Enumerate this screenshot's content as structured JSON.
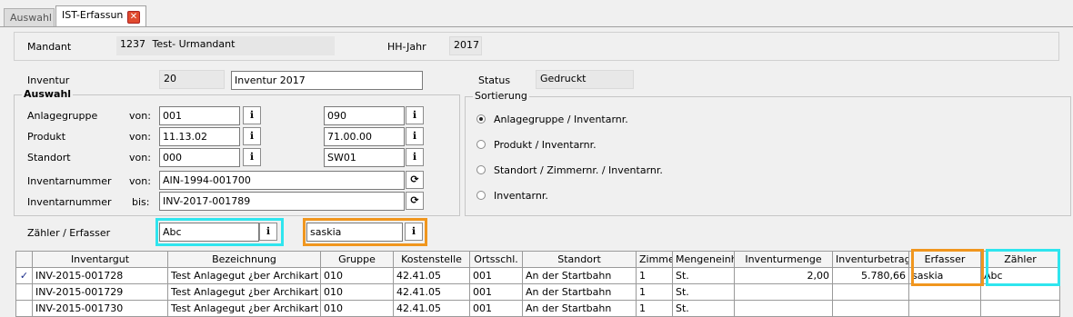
{
  "tabs": [
    {
      "label": "Auswahl"
    },
    {
      "label": "IST-Erfassun"
    }
  ],
  "header": {
    "mandant_label": "Mandant",
    "mandant_nr": "1237",
    "mandant_name": "Test- Urmandant",
    "hhjahr_label": "HH-Jahr",
    "hhjahr_value": "2017"
  },
  "inventur": {
    "label": "Inventur",
    "nr": "20",
    "name": "Inventur 2017",
    "status_label": "Status",
    "status_value": "Gedruckt"
  },
  "auswahl": {
    "title": "Auswahl",
    "rows": [
      {
        "label": "Anlagegruppe",
        "von_bis": "von:",
        "from": "001",
        "to": "090"
      },
      {
        "label": "Produkt",
        "von_bis": "von:",
        "from": "11.13.02",
        "to": "71.00.00"
      },
      {
        "label": "Standort",
        "von_bis": "von:",
        "from": "000",
        "to": "SW01"
      },
      {
        "label": "Inventarnummer",
        "von_bis": "von:",
        "from": "AIN-1994-001700"
      },
      {
        "label": "Inventarnummer",
        "von_bis": "bis:",
        "from": "INV-2017-001789"
      }
    ]
  },
  "sortierung": {
    "title": "Sortierung",
    "options": [
      {
        "label": "Anlagegruppe / Inventarnr.",
        "selected": true
      },
      {
        "label": "Produkt / Inventarnr.",
        "selected": false
      },
      {
        "label": "Standort / Zimmernr. / Inventarnr.",
        "selected": false
      },
      {
        "label": "Inventarnr.",
        "selected": false
      }
    ]
  },
  "zaehler": {
    "label": "Zähler / Erfasser",
    "zaehler_value": "Abc",
    "erfasser_value": "saskia"
  },
  "table": {
    "columns": [
      "",
      "Inventargut",
      "Bezeichnung",
      "Gruppe",
      "Kostenstelle",
      "Ortsschl.",
      "Standort",
      "Zimmer",
      "Mengeneinh.",
      "Inventurmenge",
      "Inventurbetrag",
      "Erfasser",
      "Zähler"
    ],
    "rows": [
      {
        "check": "✓",
        "inventargut": "INV-2015-001728",
        "bezeichnung": "Test Anlagegut ¿ber Archikart",
        "gruppe": "010",
        "kostenstelle": "42.41.05",
        "ortsschl": "001",
        "standort": "An der Startbahn",
        "zimmer": "1",
        "mengeneinh": "St.",
        "inventurmenge": "2,00",
        "inventurbetrag": "5.780,66",
        "erfasser": "saskia",
        "zaehler": "Abc"
      },
      {
        "check": "",
        "inventargut": "INV-2015-001729",
        "bezeichnung": "Test Anlagegut ¿ber Archikart",
        "gruppe": "010",
        "kostenstelle": "42.41.05",
        "ortsschl": "001",
        "standort": "An der Startbahn",
        "zimmer": "1",
        "mengeneinh": "St.",
        "inventurmenge": "",
        "inventurbetrag": "",
        "erfasser": "",
        "zaehler": ""
      },
      {
        "check": "",
        "inventargut": "INV-2015-001730",
        "bezeichnung": "Test Anlagegut ¿ber Archikart",
        "gruppe": "010",
        "kostenstelle": "42.41.05",
        "ortsschl": "001",
        "standort": "An der Startbahn",
        "zimmer": "1",
        "mengeneinh": "St.",
        "inventurmenge": "",
        "inventurbetrag": "",
        "erfasser": "",
        "zaehler": ""
      }
    ]
  },
  "colors": {
    "highlight_cyan": "#2fe5ee",
    "highlight_orange": "#f0961e",
    "close_red": "#e04a2e"
  },
  "icons": {
    "lookup": "info-lookup-icon",
    "cycle": "cycle-icon",
    "close": "close-icon",
    "check": "check-icon"
  }
}
